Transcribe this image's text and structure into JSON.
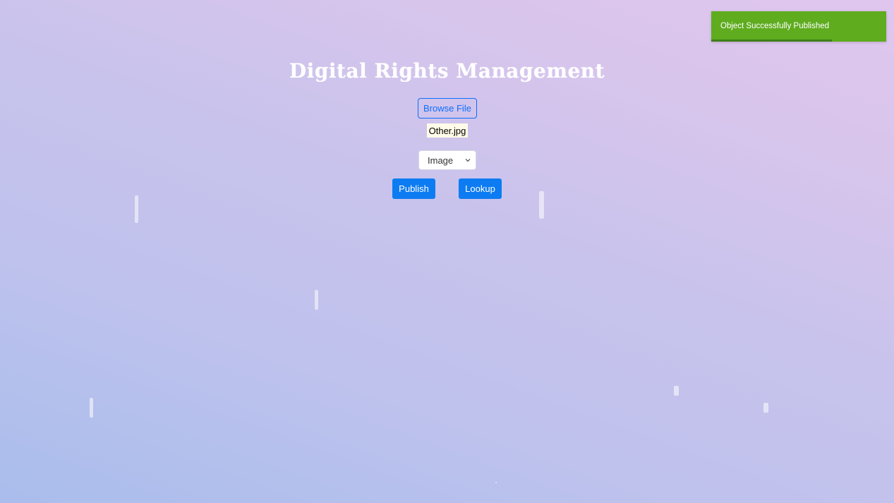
{
  "page": {
    "title": "Digital Rights Management"
  },
  "upload": {
    "browse_label": "Browse File",
    "selected_file": "Other.jpg"
  },
  "type_select": {
    "selected": "Image"
  },
  "actions": {
    "publish_label": "Publish",
    "lookup_label": "Lookup"
  },
  "toast": {
    "message": "Object Successfully Published",
    "progress_remaining": 0.69,
    "color": "#5fac1f"
  },
  "colors": {
    "accent": "#0d7cf2",
    "outline_button": "#0d6efd"
  }
}
